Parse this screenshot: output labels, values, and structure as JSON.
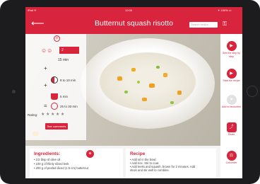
{
  "status": {
    "left": "iPad ✈",
    "time": "12:00",
    "right": "✦ 100% ▭"
  },
  "appbar": {
    "back_icon": "left-arrow-icon",
    "title": "Butternut squash risotto",
    "search_placeholder": "Search recipe...",
    "key_icon": "key-icon"
  },
  "panel": {
    "portion_value": "2",
    "prep_time": "15 min",
    "cook_time": "8 to 10 min",
    "rest_time": "5 min",
    "total_time": "25 to 33 min",
    "plus": "+",
    "equals": "=",
    "rating_label": "Rating:",
    "stars": "★★★★★",
    "comments_button": "See comments"
  },
  "actions": [
    {
      "icon": "play-icon",
      "glyph": "▶",
      "label": "See the step by step"
    },
    {
      "icon": "play-icon",
      "glyph": "▶",
      "label": "Start the recipe"
    },
    {
      "icon": "heart-icon",
      "glyph": "♥",
      "label": "Add to favourites"
    },
    {
      "icon": "share-icon",
      "glyph": "⤴",
      "label": "Share"
    },
    {
      "icon": "converter-icon",
      "glyph": "⚖",
      "label": "Converter"
    }
  ],
  "ingredients": {
    "heading": "Ingredients:",
    "items": [
      "• 1/2 tbsp of olive oil",
      "• 100 g of thinly sliced leek",
      "• 200 g of peeled diced (1.5 cm) butternut"
    ]
  },
  "recipe": {
    "heading": "Recipe",
    "items": [
      "• Add oil in the bowl.",
      "• Add rice. Stir to coat.",
      "• Add leeks and squash, brown for 2 minutes. Add",
      "  stock and stir well to combine."
    ]
  },
  "colors": {
    "accent": "#d8243c",
    "background": "#f4f4f4"
  }
}
